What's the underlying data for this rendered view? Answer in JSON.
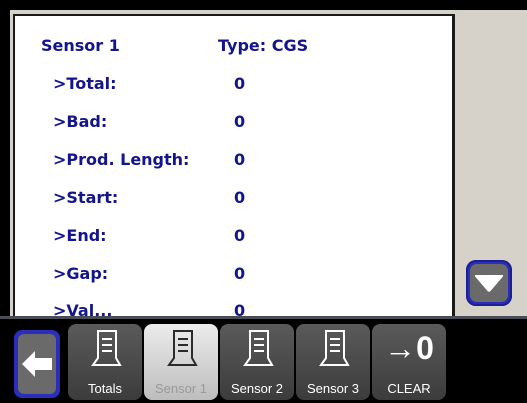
{
  "panel": {
    "header_label": "Sensor 1",
    "header_value": "Type: CGS",
    "rows": [
      {
        "label": ">Total:",
        "value": "0"
      },
      {
        "label": ">Bad:",
        "value": "0"
      },
      {
        "label": ">Prod. Length:",
        "value": "0"
      },
      {
        "label": ">Start:",
        "value": "0"
      },
      {
        "label": ">End:",
        "value": "0"
      },
      {
        "label": ">Gap:",
        "value": "0"
      },
      {
        "label": ">Val...",
        "value": "0"
      }
    ]
  },
  "scroll": {
    "icon": "triangle-down-icon"
  },
  "toolbar": {
    "back_icon": "arrow-left-icon",
    "buttons": [
      {
        "label": "Totals",
        "icon": "document-icon",
        "active": false
      },
      {
        "label": "Sensor 1",
        "icon": "document-icon",
        "active": true
      },
      {
        "label": "Sensor 2",
        "icon": "document-icon",
        "active": false
      },
      {
        "label": "Sensor 3",
        "icon": "document-icon",
        "active": false
      },
      {
        "label": "CLEAR",
        "glyph": "→0",
        "active": false
      }
    ]
  },
  "colors": {
    "text": "#14148c",
    "accent": "#2a2eb8"
  }
}
